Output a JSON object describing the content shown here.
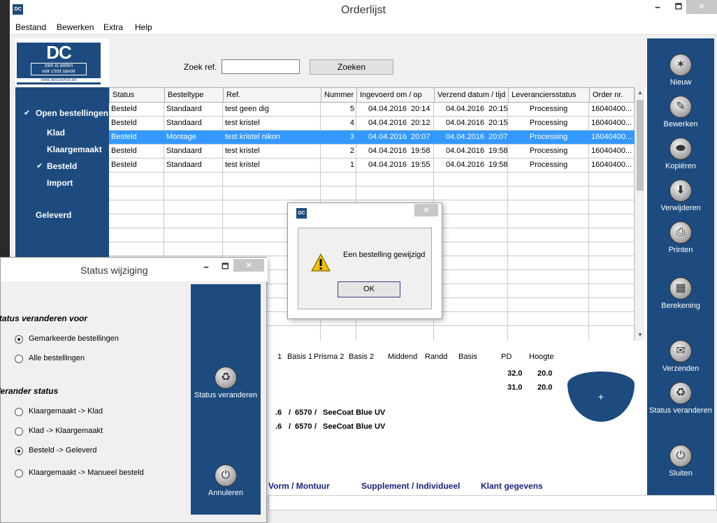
{
  "window": {
    "title": "Orderlijst",
    "icon": "DC",
    "controls": [
      "🗕",
      "🗖",
      "✕"
    ]
  },
  "menu": [
    "Bestand",
    "Bewerken",
    "Extra",
    "Help"
  ],
  "logo": {
    "name": "DC",
    "tagline1": "zien is weten",
    "tagline2": "voir c'est savoir",
    "url": "www.decouvrick.be"
  },
  "search": {
    "label": "Zoek ref.",
    "value": "",
    "button": "Zoeken"
  },
  "nav": {
    "open": "Open bestellingen",
    "klad": "Klad",
    "klaargemaakt": "Klaargemaakt",
    "besteld": "Besteld",
    "import": "Import",
    "geleverd": "Geleverd",
    "check": "✔"
  },
  "table": {
    "headers": [
      "Status",
      "Besteltype",
      "Ref.",
      "Nummer",
      "Ingevoerd om / op",
      "Verzend datum / tijd",
      "Leveranciersstatus",
      "Order nr."
    ],
    "rows": [
      {
        "status": "Besteld",
        "type": "Standaard",
        "ref": "test geen dig",
        "nummer": "5",
        "in_date": "04.04.2016",
        "in_time": "20:14",
        "out_date": "04.04.2016",
        "out_time": "20:15",
        "lev": "Processing",
        "order": "16040400..."
      },
      {
        "status": "Besteld",
        "type": "Standaard",
        "ref": "test kristel",
        "nummer": "4",
        "in_date": "04.04.2016",
        "in_time": "20:12",
        "out_date": "04.04.2016",
        "out_time": "20:15",
        "lev": "Processing",
        "order": "16040400..."
      },
      {
        "status": "Besteld",
        "type": "Montage",
        "ref": "test kristel nikon",
        "nummer": "3",
        "in_date": "04.04.2016",
        "in_time": "20:07",
        "out_date": "04.04.2016",
        "out_time": "20:07",
        "lev": "Processing",
        "order": "16040400..."
      },
      {
        "status": "Besteld",
        "type": "Standaard",
        "ref": "test kristel",
        "nummer": "2",
        "in_date": "04.04.2016",
        "in_time": "19:58",
        "out_date": "04.04.2016",
        "out_time": "19:58",
        "lev": "Processing",
        "order": "16040400..."
      },
      {
        "status": "Besteld",
        "type": "Standaard",
        "ref": "test kristel",
        "nummer": "1",
        "in_date": "04.04.2016",
        "in_time": "19:55",
        "out_date": "04.04.2016",
        "out_time": "19:58",
        "lev": "Processing",
        "order": "16040400..."
      }
    ],
    "selected_index": 2
  },
  "detail": {
    "headers": [
      "1",
      "Basis 1",
      "Prisma 2",
      "Basis 2",
      "Middend",
      "Randd",
      "Basis",
      "PD",
      "Hoogte"
    ],
    "pd1": "32.0",
    "h1": "20.0",
    "pd2": "31.0",
    "h2": "20.0",
    "lens1_a": ".6",
    "lens1_sep": "/",
    "lens1_code": "6570",
    "lens1_coat": "SeeCoat Blue UV",
    "lens2_a": ".6",
    "lens2_sep": "/",
    "lens2_code": "6570",
    "lens2_coat": "SeeCoat Blue UV",
    "links": [
      "Vorm / Montuur",
      "Supplement / Individueel",
      "Klant gegevens"
    ],
    "lens_plus": "+"
  },
  "toolbar": [
    {
      "label": "Nieuw",
      "icon": "✶"
    },
    {
      "label": "Bewerken",
      "icon": "✎"
    },
    {
      "label": "Kopiëren",
      "icon": "⬬"
    },
    {
      "label": "Verwijderen",
      "icon": "⬇"
    },
    {
      "label": "Printen",
      "icon": "⎙"
    },
    {
      "label": "Berekening",
      "icon": "▦"
    },
    {
      "label": "Verzenden",
      "icon": "✉"
    },
    {
      "label": "Status veranderen",
      "icon": "♻"
    },
    {
      "label": "Sluiten",
      "icon": "⏻"
    }
  ],
  "status_dialog": {
    "title": "Status wijziging",
    "section1": "Status veranderen voor",
    "opt_marked": "Gemarkeerde bestellingen",
    "opt_all": "Alle bestellingen",
    "section2": "Verander status",
    "opt1": "Klaargemaakt -> Klad",
    "opt2": "Klad -> Klaargemaakt",
    "opt3": "Besteld -> Geleverd",
    "opt4": "Klaargemaakt -> Manueel besteld",
    "btn_change": "Status veranderen",
    "btn_cancel": "Annuleren",
    "icon_change": "♻",
    "icon_cancel": "⏻"
  },
  "message_box": {
    "text": "Een bestelling gewijzigd",
    "ok": "OK",
    "close": "✕"
  }
}
